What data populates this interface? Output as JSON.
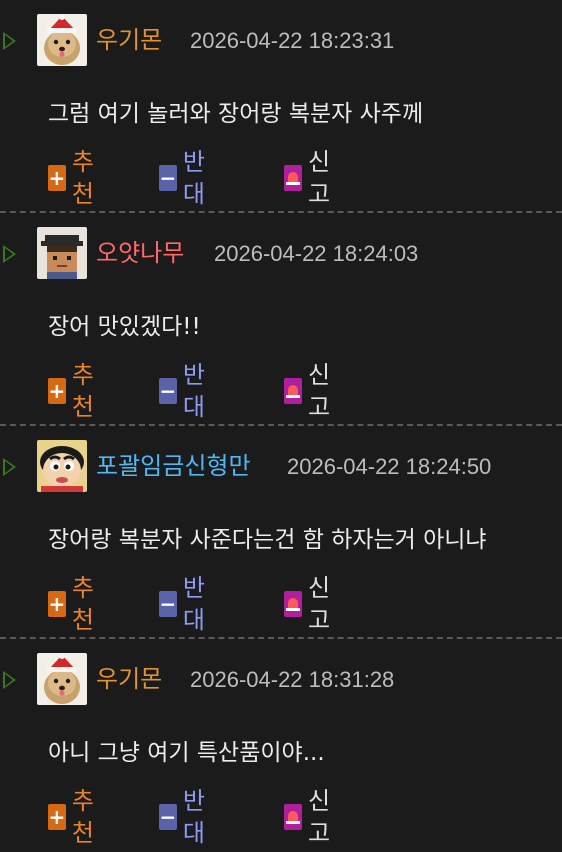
{
  "comments": [
    {
      "nickname": "우기몬",
      "nick_color": "#e2932f",
      "avatar": "dog-santa-avatar",
      "timestamp": "2026-04-22 18:23:31",
      "text": "그럼 여기 놀러와 장어랑 복분자 사주께"
    },
    {
      "nickname": "오얏나무",
      "nick_color": "#ff6a6a",
      "avatar": "pixel-graduate-avatar",
      "timestamp": "2026-04-22 18:24:03",
      "text": "장어 맛있겠다!!"
    },
    {
      "nickname": "포괄임금신형만",
      "nick_color": "#4fb7f5",
      "avatar": "cartoon-boy-avatar",
      "timestamp": "2026-04-22 18:24:50",
      "text": "장어랑 복분자 사준다는건 함 하자는거 아니냐"
    },
    {
      "nickname": "우기몬",
      "nick_color": "#e2932f",
      "avatar": "dog-santa-avatar",
      "timestamp": "2026-04-22 18:31:28",
      "text": "아니 그냥 여기 특산품이야..."
    }
  ],
  "actions": {
    "upvote_label": "추천",
    "downvote_label": "반대",
    "report_label": "신고",
    "upvote_icon": "plus-icon",
    "downvote_icon": "minus-icon",
    "report_icon": "siren-icon"
  },
  "colors": {
    "background": "#1b1b1b",
    "upvote": "#d66a14",
    "downvote": "#5b63a8",
    "report": "#b0209e",
    "arrow": "#3a7a1f"
  }
}
